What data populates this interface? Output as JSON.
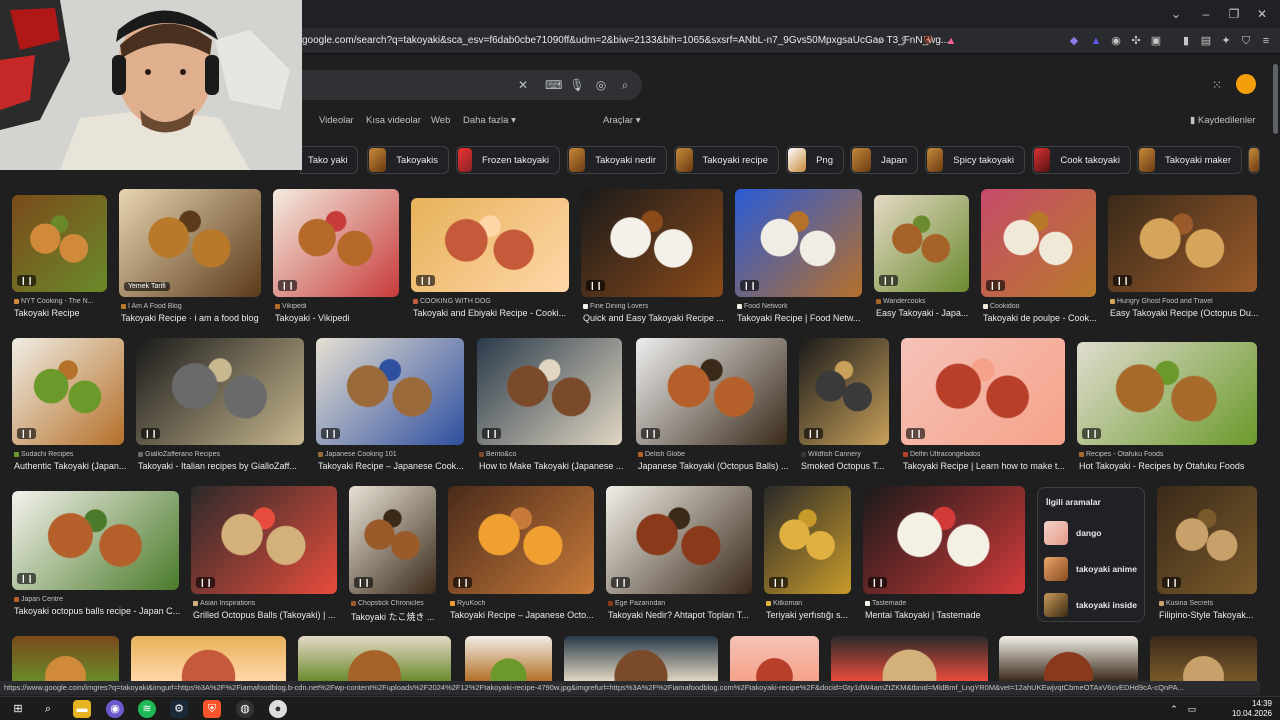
{
  "browser": {
    "url": "google.com/search?q=takoyaki&sca_esv=f6dab0cbe71090ff&udm=2&biw=2133&bih=1065&sxsrf=ANbL-n7_9Gvs50MpxgsaUcGao T3_FnN_wg...",
    "status_url": "https://www.google.com/imgres?q=takoyaki&imgurl=https%3A%2F%2Fiamafoodblog.b-cdn.net%2Fwp-content%2Fuploads%2F2024%2F12%2Ftakoyaki-recipe-4790w.jpg&imgrefurl=https%3A%2F%2Fiamafoodblog.com%2Ftakoyaki-recipe%2F&docid=Gty1dW4amZtZKM&tbnid=MldBmf_LngYR0M&vet=12ahUKEwjvqtCbmeOTAxV6cvEDHd9cA-cQnPA..."
  },
  "search": {
    "tabs": [
      "Videolar",
      "Kısa videolar",
      "Web",
      "Daha fazla",
      "Araçlar"
    ],
    "saved_label": "Kaydedilenler"
  },
  "chips": [
    "Tako yaki",
    "Takoyakis",
    "Frozen takoyaki",
    "Takoyaki nedir",
    "Takoyaki recipe",
    "Png",
    "Japan",
    "Spicy takoyaki",
    "Cook takoyaki",
    "Takoyaki maker"
  ],
  "image_badge": "Yemek Tarifi",
  "results": [
    {
      "src": "NYT Cooking - The N...",
      "title": "Takoyaki Recipe"
    },
    {
      "src": "I Am A Food Blog",
      "title": "Takoyaki Recipe · i am a food blog"
    },
    {
      "src": "Vikipedi",
      "title": "Takoyaki - Vikipedi"
    },
    {
      "src": "COOKING WITH DOG",
      "title": "Takoyaki and Ebiyaki Recipe - Cooki..."
    },
    {
      "src": "Fine Dining Lovers",
      "title": "Quick and Easy Takoyaki Recipe ..."
    },
    {
      "src": "Food Network",
      "title": "Takoyaki Recipe | Food Netw..."
    },
    {
      "src": "Wandercooks",
      "title": "Easy Takoyaki - Japa..."
    },
    {
      "src": "Cookidoo",
      "title": "Takoyaki de poulpe - Cook..."
    },
    {
      "src": "Hungry Ghost Food and Travel",
      "title": "Easy Takoyaki Recipe (Octopus Du..."
    },
    {
      "src": "Sudachi Recipes",
      "title": "Authentic Takoyaki (Japan..."
    },
    {
      "src": "GialloZafferano Recipes",
      "title": "Takoyaki - Italian recipes by GialloZaff..."
    },
    {
      "src": "Japanese Cooking 101",
      "title": "Takoyaki Recipe – Japanese Cook..."
    },
    {
      "src": "Bento&co",
      "title": "How to Make Takoyaki (Japanese ..."
    },
    {
      "src": "Delish Globe",
      "title": "Japanese Takoyaki (Octopus Balls) ..."
    },
    {
      "src": "Wildfish Cannery",
      "title": "Smoked Octopus T..."
    },
    {
      "src": "Delfin Ultracongelados",
      "title": "Takoyaki Recipe | Learn how to make t..."
    },
    {
      "src": "Recipes - Otafuku Foods",
      "title": "Hot Takoyaki - Recipes by Otafuku Foods"
    },
    {
      "src": "Japan Centre",
      "title": "Takoyaki octopus balls recipe - Japan C..."
    },
    {
      "src": "Asian Inspirations",
      "title": "Grilled Octopus Balls (Takoyaki) | ..."
    },
    {
      "src": "Chopstick Chronicles",
      "title": "Takoyaki たこ焼き ..."
    },
    {
      "src": "RyuKoch",
      "title": "Takoyaki Recipe – Japanese Octo..."
    },
    {
      "src": "Ege Pazarından",
      "title": "Takoyaki Nedir? Ahtapot Topları T..."
    },
    {
      "src": "Kitkoman",
      "title": "Teriyaki yerfıstığı s..."
    },
    {
      "src": "Tastemade",
      "title": "Mentai Takoyaki | Tastemade"
    },
    {
      "src": "Kusina Secrets",
      "title": "Filipino-Style Takoyak..."
    }
  ],
  "related": {
    "heading": "İlgili aramalar",
    "items": [
      "dango",
      "takoyaki anime",
      "takoyaki inside"
    ]
  },
  "clock": {
    "time": "14:39",
    "date": "10.04.2026"
  }
}
